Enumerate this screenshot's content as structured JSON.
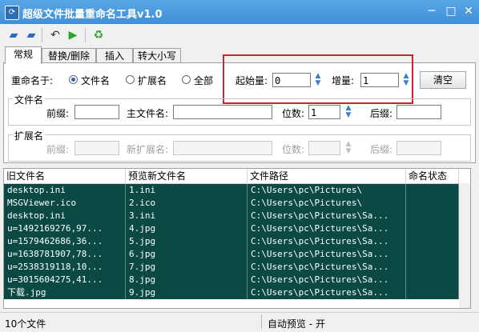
{
  "window": {
    "title": "超级文件批量重命名工具v1.0",
    "minimize": "─",
    "maximize": "□",
    "close": "✕"
  },
  "toolbar": {
    "icons": [
      "open-folder-icon",
      "open-files-icon",
      "undo-icon",
      "run-icon",
      "recycle-icon"
    ]
  },
  "tabs": [
    {
      "label": "常规",
      "active": true
    },
    {
      "label": "替换/删除"
    },
    {
      "label": "插入"
    },
    {
      "label": "转大小写"
    }
  ],
  "rename_to": {
    "label": "重命名于:",
    "options": [
      "文件名",
      "扩展名",
      "全部"
    ],
    "selected": "文件名"
  },
  "start_value": {
    "label": "起始量:",
    "value": "0"
  },
  "increment": {
    "label": "增量:",
    "value": "1"
  },
  "clear_button": "清空",
  "filename_group": {
    "title": "文件名",
    "prefix_label": "前缀:",
    "prefix_value": "",
    "main_label": "主文件名:",
    "main_value": "",
    "digits_label": "位数:",
    "digits_value": "1",
    "suffix_label": "后缀:",
    "suffix_value": ""
  },
  "ext_group": {
    "title": "扩展名",
    "prefix_label": "前缀:",
    "new_ext_label": "新扩展名:",
    "digits_label": "位数:",
    "suffix_label": "后缀:"
  },
  "table": {
    "columns": [
      "旧文件名",
      "预览新文件名",
      "文件路径",
      "命名状态"
    ],
    "rows": [
      [
        "desktop.ini",
        "1.ini",
        "C:\\Users\\pc\\Pictures\\",
        ""
      ],
      [
        "MSGViewer.ico",
        "2.ico",
        "C:\\Users\\pc\\Pictures\\",
        ""
      ],
      [
        "desktop.ini",
        "3.ini",
        "C:\\Users\\pc\\Pictures\\Sa...",
        ""
      ],
      [
        "u=1492169276,97...",
        "4.jpg",
        "C:\\Users\\pc\\Pictures\\Sa...",
        ""
      ],
      [
        "u=1579462686,36...",
        "5.jpg",
        "C:\\Users\\pc\\Pictures\\Sa...",
        ""
      ],
      [
        "u=1638781907,78...",
        "6.jpg",
        "C:\\Users\\pc\\Pictures\\Sa...",
        ""
      ],
      [
        "u=2538319118,10...",
        "7.jpg",
        "C:\\Users\\pc\\Pictures\\Sa...",
        ""
      ],
      [
        "u=3015604275,41...",
        "8.jpg",
        "C:\\Users\\pc\\Pictures\\Sa...",
        ""
      ],
      [
        "下载.jpg",
        "9.jpg",
        "C:\\Users\\pc\\Pictures\\Sa...",
        ""
      ]
    ]
  },
  "status": {
    "count": "10个文件",
    "preview": "自动预览 - 开"
  },
  "colors": {
    "titlebar": "#4a9be0",
    "row_bg": "#0b4a44",
    "highlight": "#c8282b"
  }
}
